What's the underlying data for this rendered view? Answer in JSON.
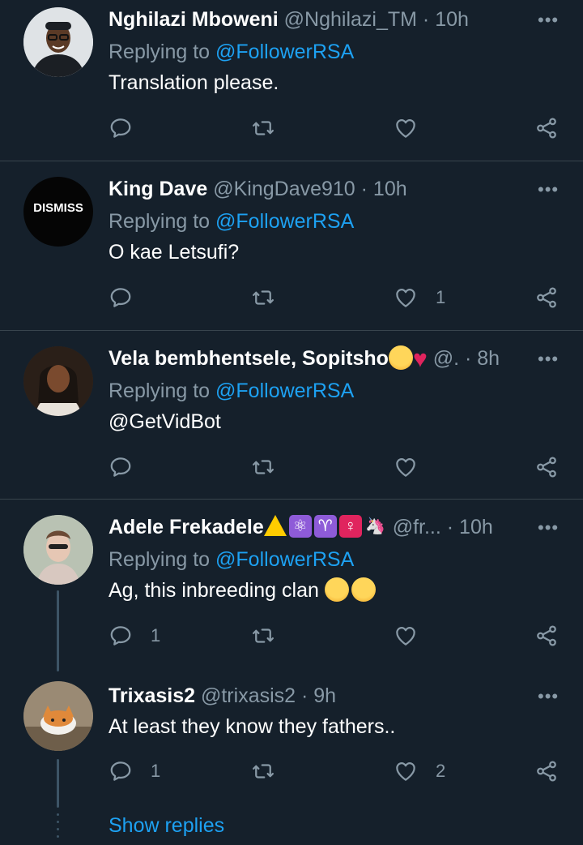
{
  "tweets": [
    {
      "name": "Nghilazi Mboweni",
      "meta": "@Nghilazi_TM · 10h",
      "replying_prefix": "Replying to ",
      "replying_to": "@FollowerRSA",
      "text": "Translation please.",
      "reply_count": "",
      "like_count": ""
    },
    {
      "name": "King Dave",
      "meta": "@KingDave910 · 10h",
      "avatar_text": "DISMISS",
      "replying_prefix": "Replying to ",
      "replying_to": "@FollowerRSA",
      "text": "O kae Letsufi?",
      "reply_count": "",
      "like_count": "1"
    },
    {
      "name": "Vela bembhentsele, Sopitsho",
      "meta": "@. · 8h",
      "replying_prefix": "Replying to ",
      "replying_to": "@FollowerRSA",
      "text": "@GetVidBot",
      "reply_count": "",
      "like_count": ""
    },
    {
      "name": "Adele Frekadele",
      "meta": "@fr... · 10h",
      "replying_prefix": "Replying to ",
      "replying_to": "@FollowerRSA",
      "text": "Ag, this inbreeding clan",
      "reply_count": "1",
      "like_count": ""
    },
    {
      "name": "Trixasis2",
      "meta": "@trixasis2 · 9h",
      "text": "At least they know they fathers..",
      "reply_count": "1",
      "like_count": "2"
    }
  ],
  "show_replies": "Show replies",
  "colors": {
    "background": "#15202b",
    "accent": "#1da1f2",
    "secondary_text": "#8899a6",
    "separator": "#38444d"
  },
  "icons": [
    "more-icon",
    "reply-icon",
    "retweet-icon",
    "like-icon",
    "share-icon"
  ]
}
